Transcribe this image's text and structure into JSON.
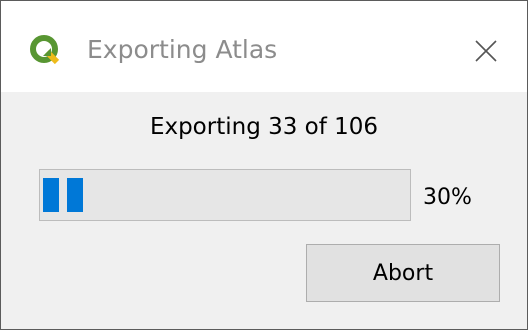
{
  "window": {
    "title": "Exporting Atlas",
    "app_icon": "qgis-logo-icon",
    "close_icon": "close-icon"
  },
  "dialog": {
    "message": "Exporting 33 of 106",
    "progress": {
      "percent_label": "30%",
      "fraction": 0.1212
    },
    "abort_label": "Abort"
  },
  "colors": {
    "accent": "#0078d7",
    "qgis_green": "#589632",
    "qgis_yellow": "#eebb1b",
    "title_text": "#8c8c8c"
  }
}
